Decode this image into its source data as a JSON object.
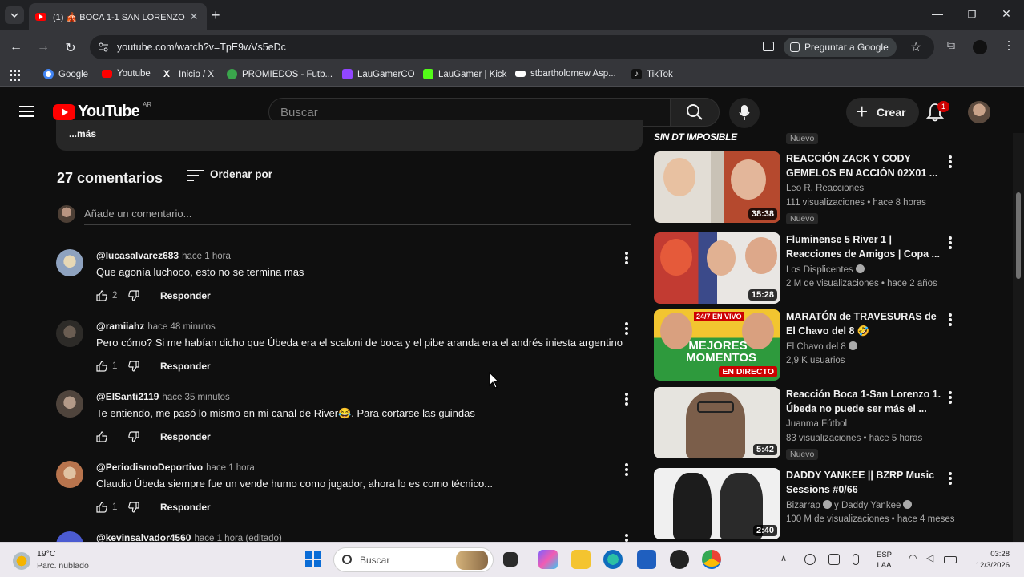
{
  "browser": {
    "tab_title": "(1) 🎪 BOCA 1-1 SAN LORENZO",
    "url": "youtube.com/watch?v=TpE9wVs5eDc",
    "ask_google": "Preguntar a Google",
    "bookmarks": [
      {
        "label": "Google",
        "color": "#4285f4"
      },
      {
        "label": "Youtube",
        "color": "#ff0000"
      },
      {
        "label": "Inicio / X",
        "color": "#000000"
      },
      {
        "label": "PROMIEDOS - Futb...",
        "color": "#3aa64c"
      },
      {
        "label": "LauGamerCO",
        "color": "#9146ff"
      },
      {
        "label": "LauGamer | Kick",
        "color": "#53fc18"
      },
      {
        "label": "stbartholomew Asp...",
        "color": "#ffffff"
      },
      {
        "label": "TikTok",
        "color": "#111111"
      }
    ]
  },
  "yt": {
    "logo": "YouTube",
    "country": "AR",
    "search_placeholder": "Buscar",
    "create": "Crear",
    "notifications": "1"
  },
  "description": {
    "more": "...más"
  },
  "comments": {
    "count_label": "27 comentarios",
    "sort_label": "Ordenar por",
    "add_placeholder": "Añade un comentario...",
    "reply_label": "Responder",
    "items": [
      {
        "author": "@lucasalvarez683",
        "time": "hace 1 hora",
        "text": "Que agonía luchooo, esto no se termina mas",
        "likes": "2",
        "avatar_color": "#a7b5c9"
      },
      {
        "author": "@ramiiahz",
        "time": "hace 48 minutos",
        "text": "Pero cómo? Si me habían dicho que Úbeda era el scaloni de boca y el pibe aranda era el andrés iniesta argentino",
        "likes": "1",
        "avatar_color": "#3b3a36"
      },
      {
        "author": "@ElSanti2119",
        "time": "hace 35 minutos",
        "text": "Te entiendo, me pasó lo mismo en mi canal de River😂. Para cortarse las guindas",
        "likes": "",
        "avatar_color": "#6a5c52"
      },
      {
        "author": "@PeriodismoDeportivo",
        "time": "hace 1 hora",
        "text": "Claudio Úbeda siempre fue un vende humo como jugador, ahora lo es como técnico...",
        "likes": "1",
        "avatar_color": "#d8b08a"
      },
      {
        "author": "@kevinsalvador4560",
        "time": "hace 1 hora (editado)",
        "text": "",
        "likes": "",
        "avatar_color": "#4b5bd1"
      }
    ]
  },
  "sidebar": {
    "top_thumb_text": "SIN DT IMPOSIBLE",
    "top_badge": "Nuevo",
    "videos": [
      {
        "title": "REACCIÓN ZACK Y CODY GEMELOS EN ACCIÓN 02X01 ...",
        "channel": "Leo R. Reacciones",
        "stats": "111 visualizaciones • hace 8 horas",
        "duration": "38:38",
        "badge": "Nuevo",
        "verified": false,
        "thumb_a": "#d9d5cf",
        "thumb_b": "#b5492e"
      },
      {
        "title": "Fluminense 5 River 1 | Reacciones de Amigos | Copa ...",
        "channel": "Los Displicentes",
        "stats": "2 M de visualizaciones • hace 2 años",
        "duration": "15:28",
        "badge": "",
        "verified": true,
        "thumb_a": "#c23b32",
        "thumb_b": "#e9e6e3"
      },
      {
        "title": "MARATÓN de TRAVESURAS de El Chavo del 8 🤣",
        "channel": "El Chavo del 8",
        "stats": "2,9 K usuarios",
        "duration": "",
        "live": "EN DIRECTO",
        "badge": "",
        "verified": true,
        "thumb_a": "#2e9a3d",
        "thumb_b": "#f2c530",
        "thumb_text": "MEJORES MOMENTOS",
        "thumb_tag": "24/7 EN VIVO"
      },
      {
        "title": "Reacción Boca 1-San Lorenzo 1. Úbeda no puede ser más el ...",
        "channel": "Juanma Fútbol",
        "stats": "83 visualizaciones • hace 5 horas",
        "duration": "5:42",
        "badge": "Nuevo",
        "verified": false,
        "thumb_a": "#e6e4df",
        "thumb_b": "#7b5e4a"
      },
      {
        "title": "DADDY YANKEE || BZRP Music Sessions #0/66",
        "channel": "Bizarrap",
        "channel2": "y Daddy Yankee",
        "stats": "100 M de visualizaciones • hace 4 meses",
        "duration": "2:40",
        "badge": "",
        "verified": true,
        "thumb_a": "#f0f0f0",
        "thumb_b": "#1c1c1c"
      }
    ]
  },
  "taskbar": {
    "temp": "19°C",
    "condition": "Parc. nublado",
    "search": "Buscar",
    "lang_top": "ESP",
    "lang_bottom": "LAA",
    "time": "03:28",
    "date": "12/3/2026"
  }
}
